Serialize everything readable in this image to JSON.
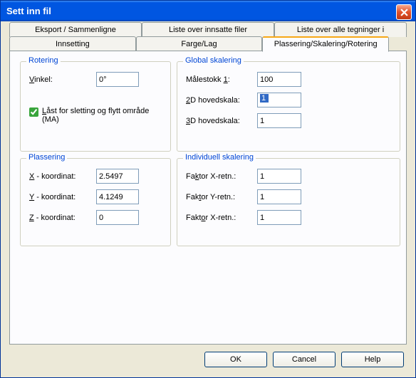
{
  "window": {
    "title": "Sett inn fil"
  },
  "tabs_top": [
    "Eksport / Sammenligne",
    "Liste over innsatte filer",
    "Liste over alle tegninger i prosjektet"
  ],
  "tabs_bottom": [
    "Innsetting",
    "Farge/Lag",
    "Plassering/Skalering/Rotering"
  ],
  "groups": {
    "rotering": {
      "title": "Rotering",
      "vinkel_label_pre": "V",
      "vinkel_label_post": "inkel:",
      "vinkel_value": "0°",
      "lock_label_pre": "L",
      "lock_label_post": "åst for sletting og flytt område (MA)",
      "lock_checked": true
    },
    "global": {
      "title": "Global skalering",
      "malestokk_label": "Målestokk  ",
      "malestokk_u": "1",
      "malestokk_post": ":",
      "malestokk_value": "100",
      "d2_pre": "2",
      "d2_post": "D hovedskala:",
      "d2_value": "1",
      "d3_pre": "3",
      "d3_post": "D hovedskala:",
      "d3_value": "1"
    },
    "plassering": {
      "title": "Plassering",
      "x_u": "X",
      "x_post": " - koordinat:",
      "x_value": "2.5497",
      "y_u": "Y",
      "y_post": " - koordinat:",
      "y_value": "4.1249",
      "z_u": "Z",
      "z_post": " - koordinat:",
      "z_value": "0"
    },
    "individuell": {
      "title": "Individuell skalering",
      "fx_pre": "Fa",
      "fx_u": "k",
      "fx_post": "tor X-retn.:",
      "fx_value": "1",
      "fy_pre": "Fak",
      "fy_u": "t",
      "fy_post": "or Y-retn.:",
      "fy_value": "1",
      "fz_pre": "Fakt",
      "fz_u": "o",
      "fz_post": "r X-retn.:",
      "fz_value": "1"
    }
  },
  "buttons": {
    "ok": "OK",
    "cancel": "Cancel",
    "help": "Help"
  }
}
